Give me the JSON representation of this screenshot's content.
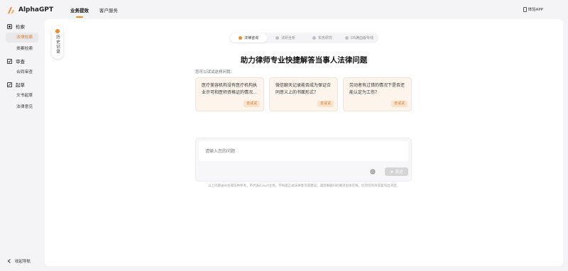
{
  "app": {
    "name": "AlphaGPT",
    "accent": "#f08a2a"
  },
  "header": {
    "nav": [
      {
        "label": "业务提效"
      },
      {
        "label": "客户服务"
      }
    ],
    "download_label": "体验APP"
  },
  "sidebar": {
    "groups": [
      {
        "label": "检索",
        "icon": "search-icon",
        "items": [
          {
            "label": "法律检索"
          },
          {
            "label": "类案检索"
          }
        ]
      },
      {
        "label": "审查",
        "icon": "review-icon",
        "items": [
          {
            "label": "合同审查"
          }
        ]
      },
      {
        "label": "起草",
        "icon": "draft-icon",
        "items": [
          {
            "label": "文书起草"
          },
          {
            "label": "法律意见"
          }
        ]
      }
    ],
    "collapse_label": "收起导航"
  },
  "history": {
    "label": "历史记录"
  },
  "tabs": [
    {
      "label": "法律咨询",
      "icon": "chat-icon"
    },
    {
      "label": "法研全析",
      "icon": "analysis-icon"
    },
    {
      "label": "实务研究",
      "icon": "research-icon"
    },
    {
      "label": "DS满血版专线",
      "icon": "ds-icon"
    }
  ],
  "main": {
    "title": "助力律师专业快捷解答当事人法律问题",
    "hint": "您可以试试这样问我：",
    "cards": [
      {
        "text": "医疗美容机构没有医疗机构执业许可和医师资格证的情况…",
        "button": "去试试"
      },
      {
        "text": "微信聊天记录能否成为保证合同意义上的书面形式？",
        "button": "去试试"
      },
      {
        "text": "劳动者有过错的情况下是否还能认定为工伤？",
        "button": "去试试"
      }
    ],
    "input": {
      "placeholder": "请输入您的问题",
      "send_label": "发送"
    },
    "disclaimer": "以上内容由AI生成仅供参考，不代表iCourt立场，不构成正式法律意见或建议。请您根据AI的要求主体在线，切勿仅凭AI答案作出决定。"
  }
}
